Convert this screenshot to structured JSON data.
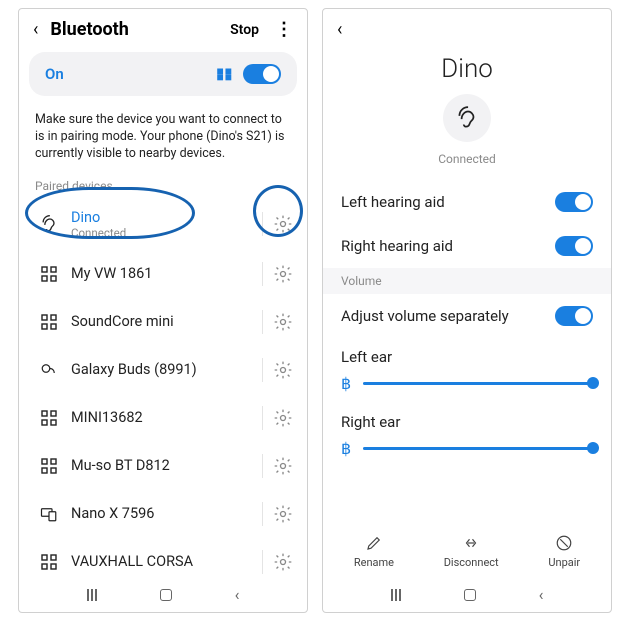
{
  "left": {
    "header": {
      "title": "Bluetooth",
      "stop": "Stop"
    },
    "on_label": "On",
    "instruction": "Make sure the device you want to connect to is in pairing mode. Your phone (Dino's S21) is currently visible to nearby devices.",
    "paired_section": "Paired devices",
    "devices": [
      {
        "name": "Dino",
        "subtitle": "Connected",
        "icon": "hearing",
        "connected": true
      },
      {
        "name": "My VW 1861",
        "icon": "grid"
      },
      {
        "name": "SoundCore mini",
        "icon": "grid"
      },
      {
        "name": "Galaxy Buds (8991)",
        "icon": "buds"
      },
      {
        "name": "MINI13682",
        "icon": "grid"
      },
      {
        "name": "Mu-so BT D812",
        "icon": "grid"
      },
      {
        "name": "Nano X 7596",
        "icon": "devices"
      },
      {
        "name": "VAUXHALL CORSA",
        "icon": "grid"
      }
    ]
  },
  "right": {
    "title": "Dino",
    "status": "Connected",
    "rows": {
      "left_aid": "Left hearing aid",
      "right_aid": "Right hearing aid"
    },
    "volume_section": "Volume",
    "adjust_sep": "Adjust volume separately",
    "left_ear": "Left ear",
    "right_ear": "Right ear",
    "actions": {
      "rename": "Rename",
      "disconnect": "Disconnect",
      "unpair": "Unpair"
    }
  }
}
